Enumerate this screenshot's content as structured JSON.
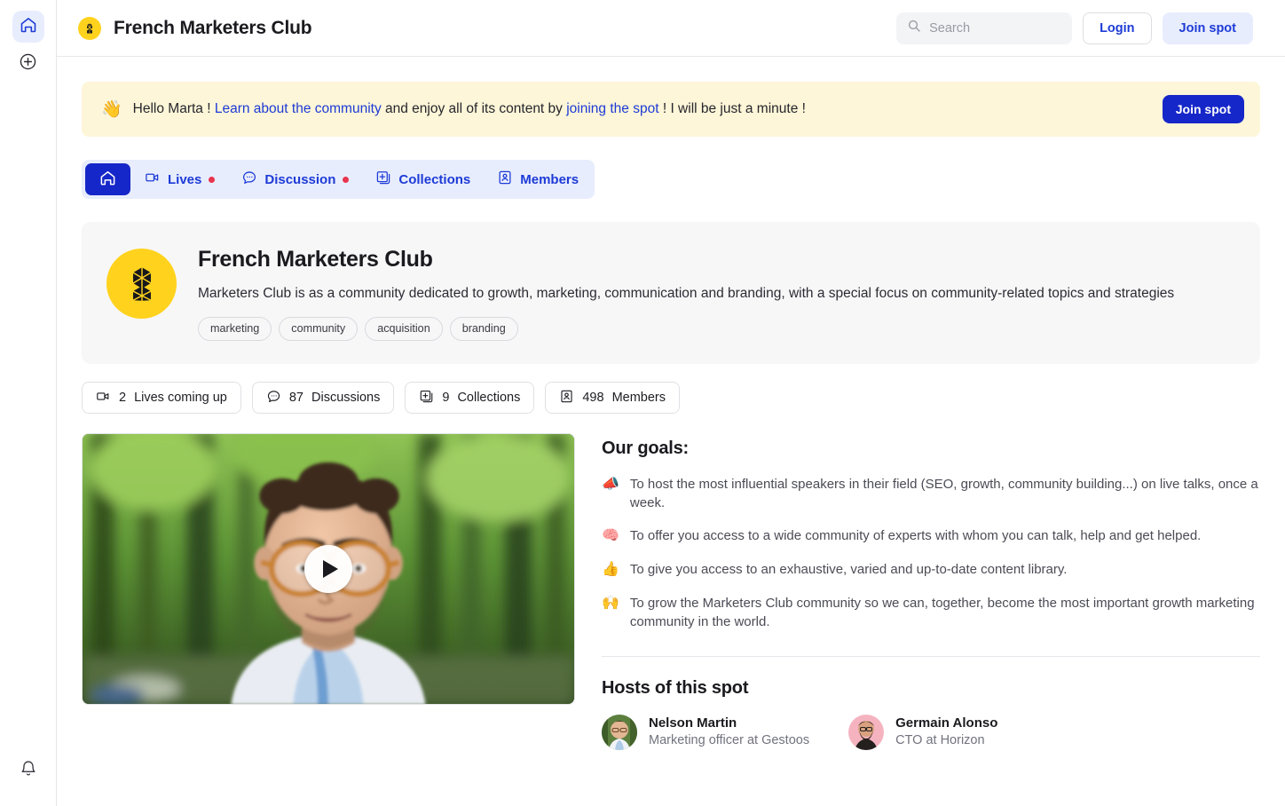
{
  "rail": {
    "home_label": "Home",
    "create_label": "Create",
    "notifications_label": "Notifications"
  },
  "header": {
    "logo_alt": "French Marketers Club logo",
    "title": "French Marketers Club",
    "search_placeholder": "Search",
    "search_value": "",
    "login_label": "Login",
    "join_label": "Join spot"
  },
  "notice": {
    "emoji": "👋",
    "greeting": "Hello Marta !",
    "link1": "Learn about the community",
    "middle": "and enjoy all of its content by",
    "link2": "joining the spot",
    "tail": "! I will be just a minute !",
    "button_label": "Join spot"
  },
  "tabs": [
    {
      "label": "",
      "icon": "home-icon",
      "active": true,
      "badge": false
    },
    {
      "label": "Lives",
      "icon": "video-camera-icon",
      "active": false,
      "badge": true
    },
    {
      "label": "Discussion",
      "icon": "chat-bubble-icon",
      "active": false,
      "badge": true
    },
    {
      "label": "Collections",
      "icon": "collections-icon",
      "active": false,
      "badge": false
    },
    {
      "label": "Members",
      "icon": "members-icon",
      "active": false,
      "badge": false
    }
  ],
  "spot": {
    "name": "French Marketers Club",
    "description": "Marketers Club is as a community dedicated to growth, marketing, communication and branding, with a special focus on community-related topics and strategies",
    "tags": [
      "marketing",
      "community",
      "acquisition",
      "branding"
    ]
  },
  "stats": [
    {
      "icon": "video-camera-icon",
      "count": "2",
      "label": "Lives coming up"
    },
    {
      "icon": "chat-bubble-icon",
      "count": "87",
      "label": "Discussions"
    },
    {
      "icon": "collections-icon",
      "count": "9",
      "label": "Collections"
    },
    {
      "icon": "members-icon",
      "count": "498",
      "label": "Members"
    }
  ],
  "video": {
    "alt": "Intro video thumbnail — man with glasses in a tree-lined avenue",
    "play_label": "Play"
  },
  "goals": {
    "title": "Our goals:",
    "items": [
      {
        "emoji": "📣",
        "text": "To host the most influential speakers in their field (SEO, growth, community building...) on live talks, once a week."
      },
      {
        "emoji": "🧠",
        "text": "To offer you access to a wide community of experts with whom you can talk, help and get helped."
      },
      {
        "emoji": "👍",
        "text": "To give you access to an exhaustive, varied and up-to-date content library."
      },
      {
        "emoji": "🙌",
        "text": "To grow the Marketers Club community so we can, together, become the most important growth marketing community in the world."
      }
    ]
  },
  "hosts": {
    "title": "Hosts of this spot",
    "people": [
      {
        "name": "Nelson Martin",
        "role": "Marketing officer at Gestoos",
        "avatar_bg": "#5c7f3e"
      },
      {
        "name": "Germain Alonso",
        "role": "CTO at Horizon",
        "avatar_bg": "#f5b3c0"
      }
    ]
  },
  "colors": {
    "accent_blue": "#1627c9",
    "soft_blue": "#e8edfd",
    "brand_yellow": "#ffd21e",
    "banner_yellow": "#fdf6d8",
    "badge_red": "#e8344e"
  }
}
